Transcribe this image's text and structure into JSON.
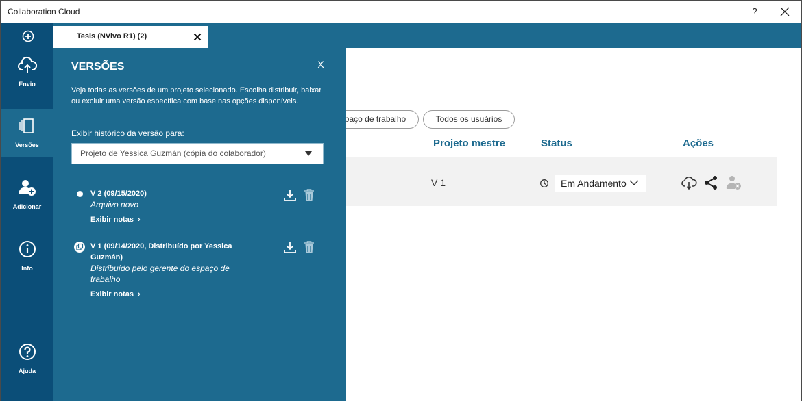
{
  "window": {
    "title": "Collaboration Cloud",
    "help": "?"
  },
  "tab": {
    "label": "Tesis (NVivo R1) (2)"
  },
  "sidebar": {
    "items": [
      {
        "label": "Envio",
        "icon": "cloud-upload-icon"
      },
      {
        "label": "Versões",
        "icon": "versions-icon"
      },
      {
        "label": "Adicionar",
        "icon": "add-user-icon"
      },
      {
        "label": "Info",
        "icon": "info-icon"
      },
      {
        "label": "Ajuda",
        "icon": "help-icon"
      }
    ]
  },
  "panel": {
    "title": "VERSÕES",
    "close": "X",
    "description": "Veja todas as versões de um projeto selecionado. Escolha distribuir, baixar ou excluir uma versão específica com base nas opções disponíveis.",
    "history_label": "Exibir histórico da versão para:",
    "selected_project": "Projeto de Yessica Guzmán (cópia do colaborador)",
    "versions": [
      {
        "heading": "V 2 (09/15/2020)",
        "subtitle": "Arquivo novo",
        "notes": "Exibir notas"
      },
      {
        "heading": "V 1 (09/14/2020, Distribuído por Yessica Guzmán)",
        "subtitle": "Distribuído pelo gerente do espaço de trabalho",
        "notes": "Exibir notas"
      }
    ]
  },
  "main": {
    "filters": {
      "workspace": "paço de trabalho",
      "all_users": "Todos os usuários"
    },
    "columns": {
      "master": "Projeto mestre",
      "status": "Status",
      "actions": "Ações"
    },
    "row": {
      "master_version": "V 1",
      "status": "Em Andamento"
    }
  },
  "colors": {
    "panel": "#1d6a8f",
    "sidebar": "#0b4e78",
    "accent": "#1d6a8f"
  }
}
